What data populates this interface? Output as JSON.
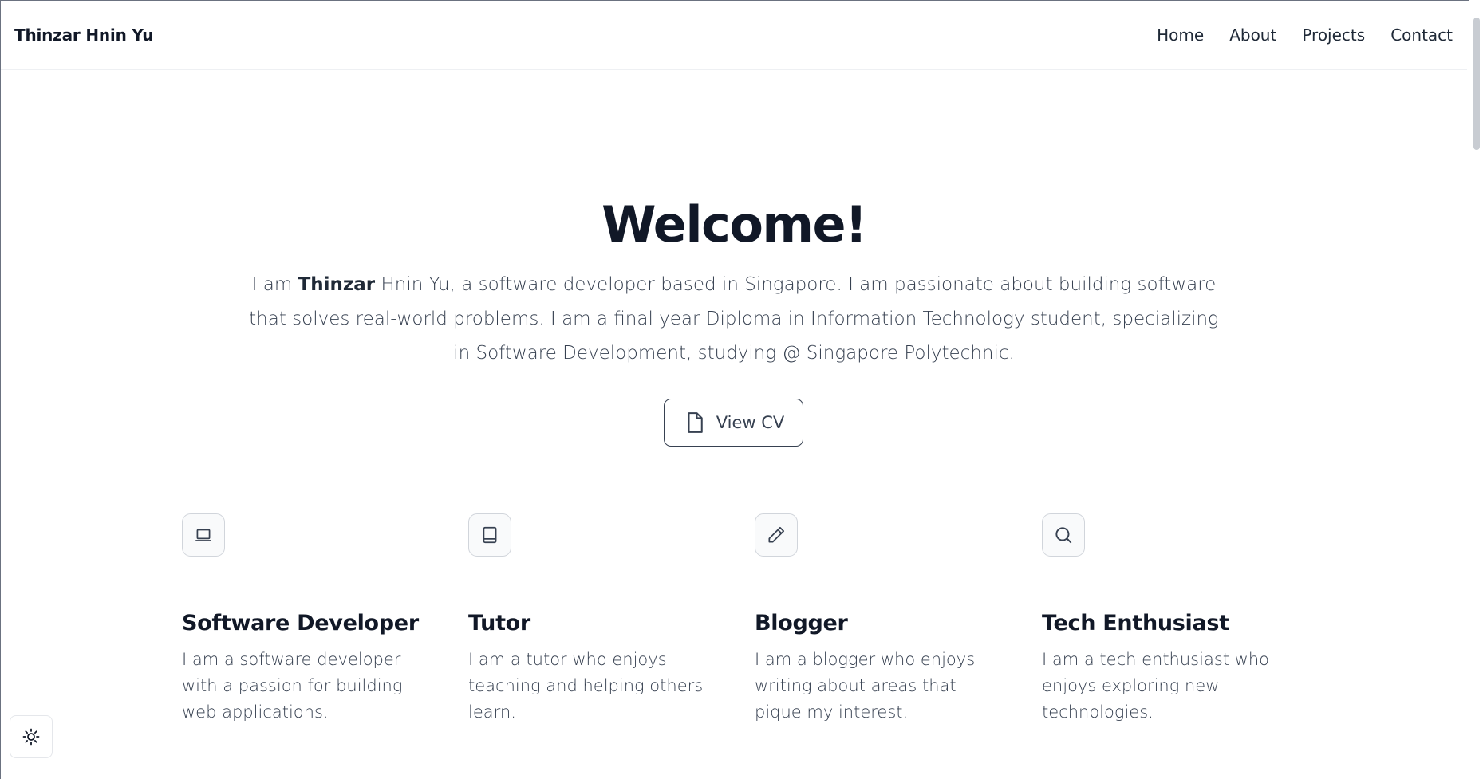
{
  "header": {
    "brand": "Thinzar Hnin Yu",
    "nav": [
      {
        "label": "Home"
      },
      {
        "label": "About"
      },
      {
        "label": "Projects"
      },
      {
        "label": "Contact"
      }
    ]
  },
  "hero": {
    "title": "Welcome!",
    "intro_prefix": "I am ",
    "intro_bold": "Thinzar",
    "intro_rest": " Hnin Yu, a software developer based in Singapore. I am passionate about building software that solves real-world problems. I am a final year Diploma in Information Technology student, specializing in Software Development, studying @ Singapore Polytechnic.",
    "cv_label": "View CV"
  },
  "cards": [
    {
      "icon": "laptop-icon",
      "title": "Software Developer",
      "text": "I am a software developer with a passion for building web applications."
    },
    {
      "icon": "book-icon",
      "title": "Tutor",
      "text": "I am a tutor who enjoys teaching and helping others learn."
    },
    {
      "icon": "pencil-icon",
      "title": "Blogger",
      "text": "I am a blogger who enjoys writing about areas that pique my interest."
    },
    {
      "icon": "search-icon",
      "title": "Tech Enthusiast",
      "text": "I am a tech enthusiast who enjoys exploring new technologies."
    }
  ],
  "theme_toggle": {
    "icon": "sun-icon"
  },
  "colors": {
    "text": "#1f2937",
    "heading": "#111827",
    "border": "#d1d5db"
  }
}
